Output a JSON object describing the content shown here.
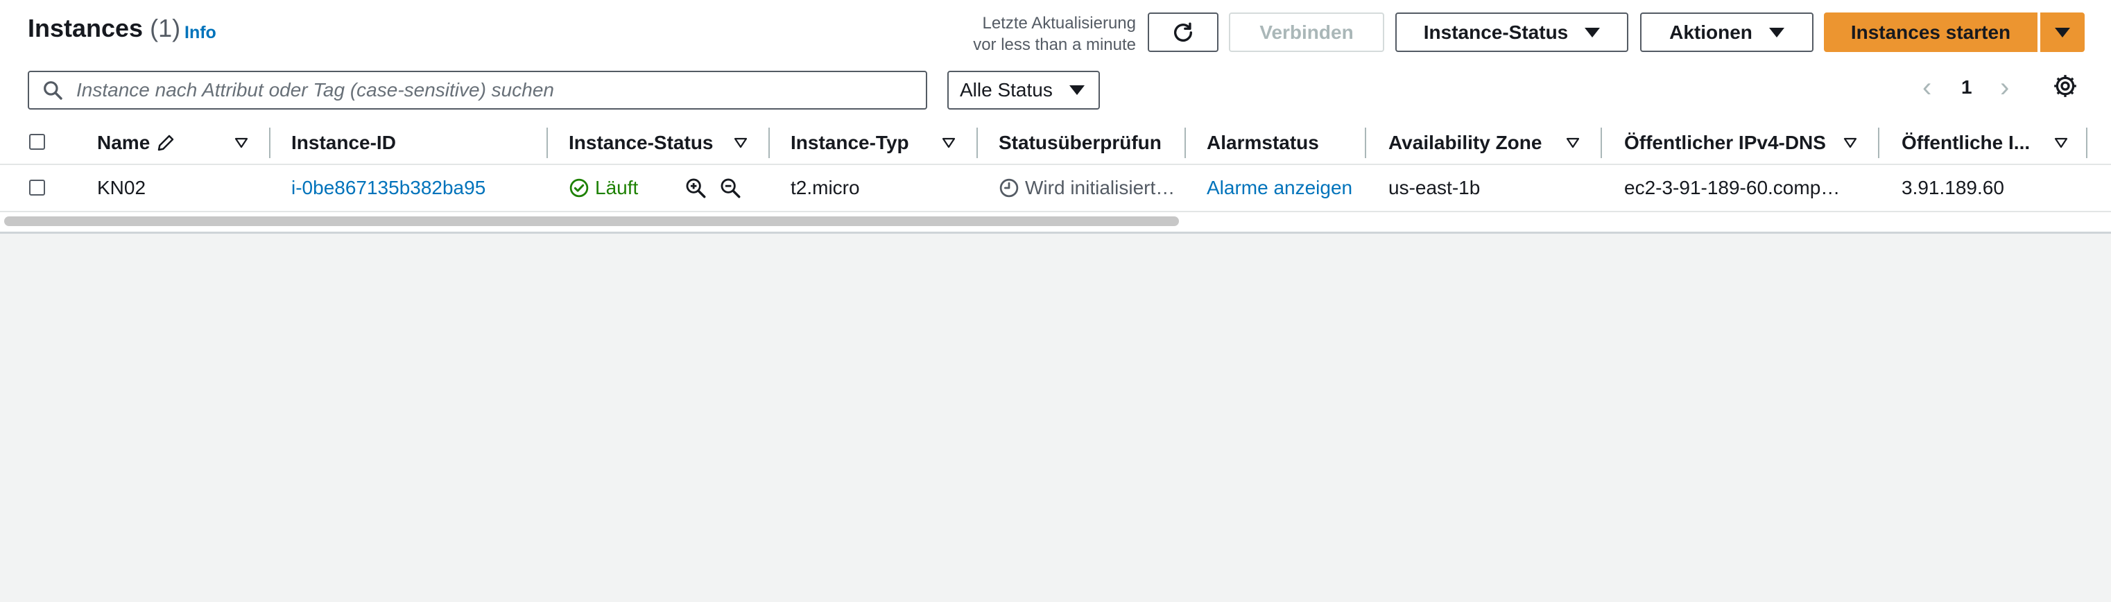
{
  "header": {
    "title": "Instances",
    "count": "(1)",
    "info": "Info",
    "last_update_line1": "Letzte Aktualisierung",
    "last_update_line2": "vor less than a minute"
  },
  "toolbar": {
    "refresh_icon": "refresh-icon",
    "connect_label": "Verbinden",
    "instance_state_label": "Instance-Status",
    "actions_label": "Aktionen",
    "launch_label": "Instances starten"
  },
  "search": {
    "placeholder": "Instance nach Attribut oder Tag (case-sensitive) suchen"
  },
  "filter": {
    "selected": "Alle Status"
  },
  "pagination": {
    "page": "1",
    "prev": "‹",
    "next": "›"
  },
  "columns": {
    "name": "Name",
    "instance_id": "Instance-ID",
    "instance_state": "Instance-Status",
    "instance_type": "Instance-Typ",
    "status_check": "Statusüberprüfun",
    "alarm_status": "Alarmstatus",
    "availability_zone": "Availability Zone",
    "public_dns": "Öffentlicher IPv4-DNS",
    "public_ip": "Öffentliche I..."
  },
  "rows": [
    {
      "name": "KN02",
      "instance_id": "i-0be867135b382ba95",
      "state": "Läuft",
      "type": "t2.micro",
      "status_check": "Wird initialisiert…",
      "alarm": "Alarme anzeigen",
      "zone": "us-east-1b",
      "dns": "ec2-3-91-189-60.comp…",
      "ip": "3.91.189.60"
    }
  ],
  "colors": {
    "accent": "#0073bb",
    "primary_button": "#ec9530",
    "running": "#1d8102",
    "text": "#16191f"
  }
}
